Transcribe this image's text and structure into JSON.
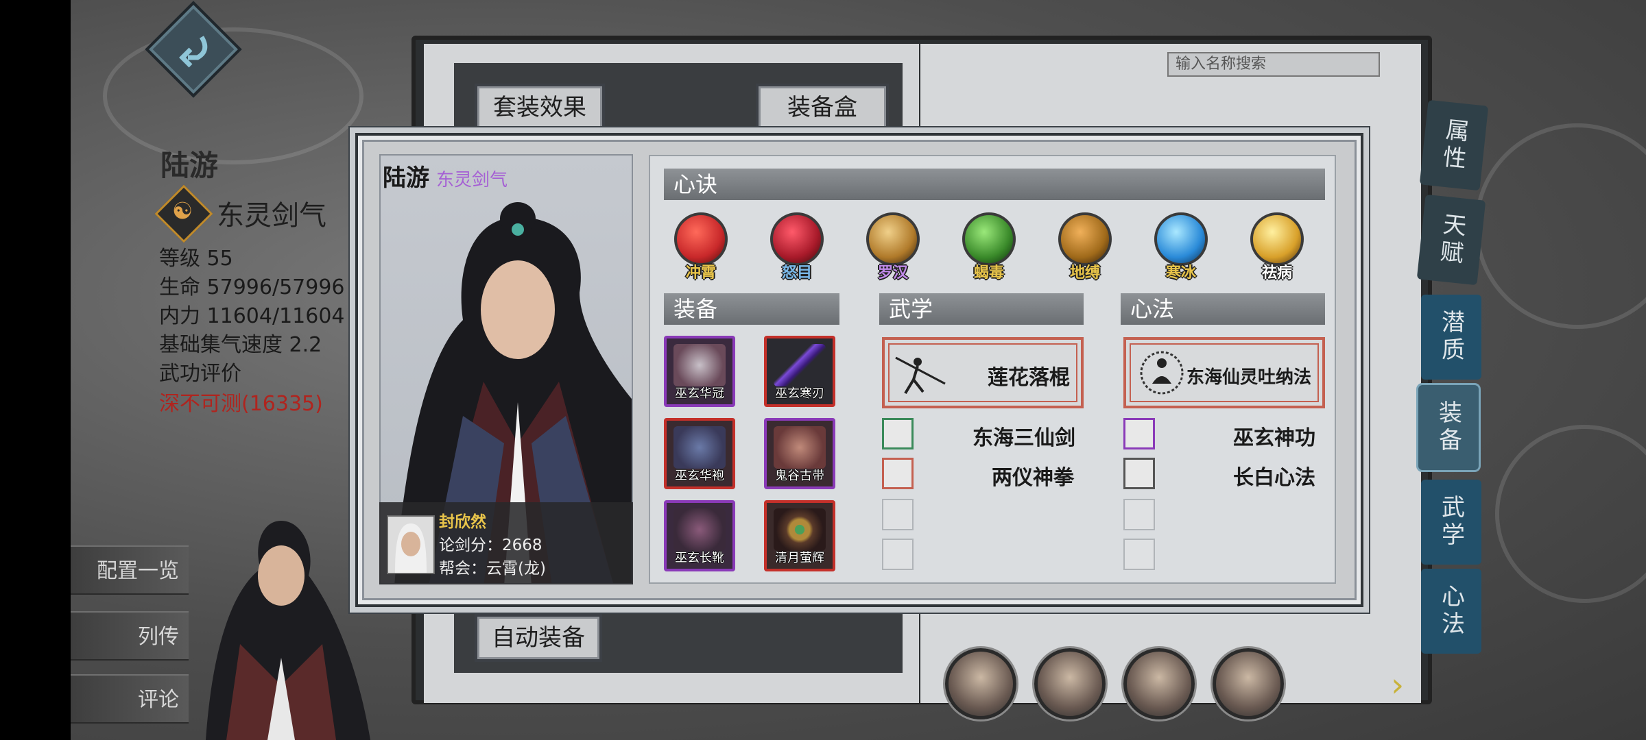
{
  "left": {
    "name": "陆游",
    "school": "东灵剑气",
    "stats": {
      "level": "等级 55",
      "hp": "生命 57996/57996",
      "mp": "内力 11604/11604",
      "speed": "基础集气速度 2.2",
      "rating_label": "武功评价",
      "rating_value": "深不可测(16335)"
    },
    "buttons": [
      "配置一览",
      "列传",
      "评论"
    ]
  },
  "book": {
    "set_effect": "套装效果",
    "equip_box": "装备盒",
    "auto_equip": "自动装备",
    "search_placeholder": "输入名称搜索",
    "tabs": [
      "属性",
      "天赋",
      "潜质",
      "装备",
      "武学",
      "心法"
    ]
  },
  "modal": {
    "name": "陆游",
    "school": "东灵剑气",
    "player": {
      "name": "封欣然",
      "score": "论剑分：2668",
      "guild": "帮会：云霄(龙)"
    },
    "sections": {
      "heart": "心诀",
      "equip": "装备",
      "martial": "武学",
      "method": "心法"
    },
    "hearts": [
      {
        "label": "冲霄",
        "color": "#c8282a"
      },
      {
        "label": "怒目",
        "color": "#a81a2a"
      },
      {
        "label": "罗汉",
        "color": "#d4a23a"
      },
      {
        "label": "蝎毒",
        "color": "#4aa03a"
      },
      {
        "label": "地缚",
        "color": "#c88a2a"
      },
      {
        "label": "寒冰",
        "color": "#3a9ad8"
      },
      {
        "label": "祛病",
        "color": "#d8a02a"
      }
    ],
    "equipment": [
      {
        "label": "巫玄华冠",
        "frame": "#8a3ab8"
      },
      {
        "label": "巫玄寒刃",
        "frame": "#c4302a"
      },
      {
        "label": "巫玄华袍",
        "frame": "#c4302a"
      },
      {
        "label": "鬼谷古带",
        "frame": "#8a3ab8"
      },
      {
        "label": "巫玄长靴",
        "frame": "#8a3ab8"
      },
      {
        "label": "清月萤辉",
        "frame": "#c4302a"
      }
    ],
    "martial": {
      "main": "莲花落棍",
      "list": [
        "东海三仙剑",
        "两仪神拳"
      ]
    },
    "method": {
      "main": "东海仙灵吐纳法",
      "list": [
        "巫玄神功",
        "长白心法"
      ]
    }
  }
}
